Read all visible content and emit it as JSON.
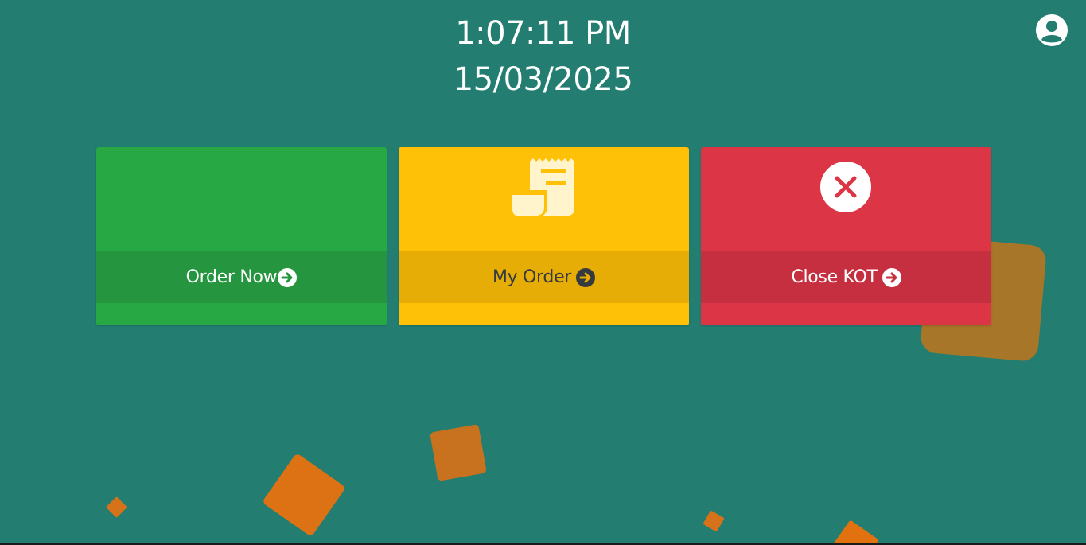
{
  "header": {
    "time": "1:07:11 PM",
    "date": "15/03/2025"
  },
  "user": {
    "icon": "user-circle-icon"
  },
  "cards": [
    {
      "label": "Order Now",
      "icon": "",
      "arrow_icon": "arrow-circle-right-icon",
      "color": "#28a745"
    },
    {
      "label": "My Order",
      "icon": "receipt-icon",
      "arrow_icon": "arrow-circle-right-icon",
      "color": "#ffc107"
    },
    {
      "label": "Close KOT",
      "icon": "close-circle-icon",
      "arrow_icon": "arrow-circle-right-icon",
      "color": "#dc3545"
    }
  ],
  "colors": {
    "background": "#237d71",
    "accent_orange": "#dc7214"
  }
}
